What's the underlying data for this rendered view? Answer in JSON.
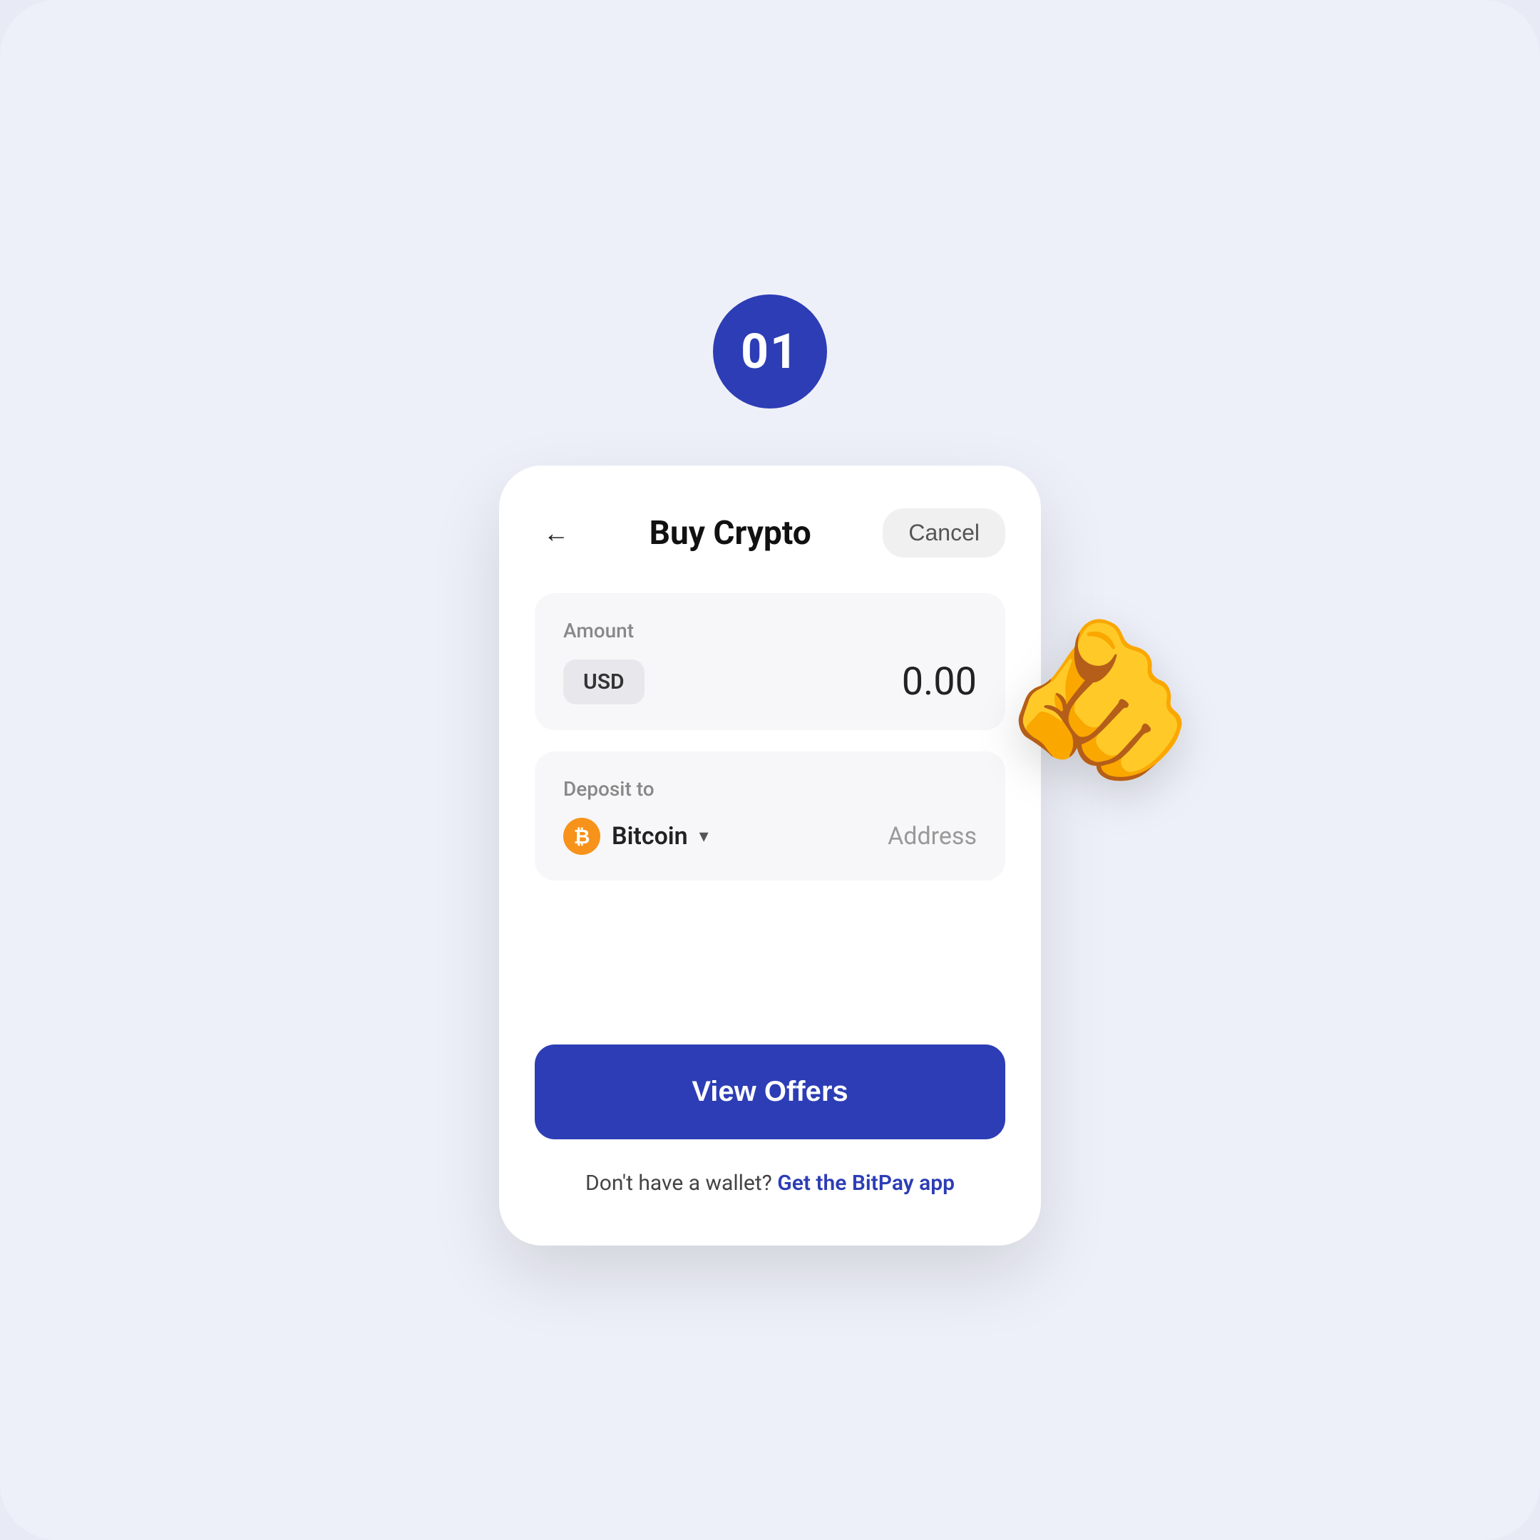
{
  "page": {
    "background_color": "#eef0f9"
  },
  "step_badge": {
    "number": "01"
  },
  "header": {
    "title": "Buy Crypto",
    "cancel_label": "Cancel",
    "back_aria": "Go back"
  },
  "amount_section": {
    "label": "Amount",
    "currency": "USD",
    "value": "0.00"
  },
  "deposit_section": {
    "label": "Deposit to",
    "crypto_name": "Bitcoin",
    "address_placeholder": "Address"
  },
  "cta": {
    "view_offers_label": "View Offers"
  },
  "footer": {
    "wallet_prompt_text": "Don't have a wallet?",
    "wallet_link_text": "Get the BitPay app"
  }
}
